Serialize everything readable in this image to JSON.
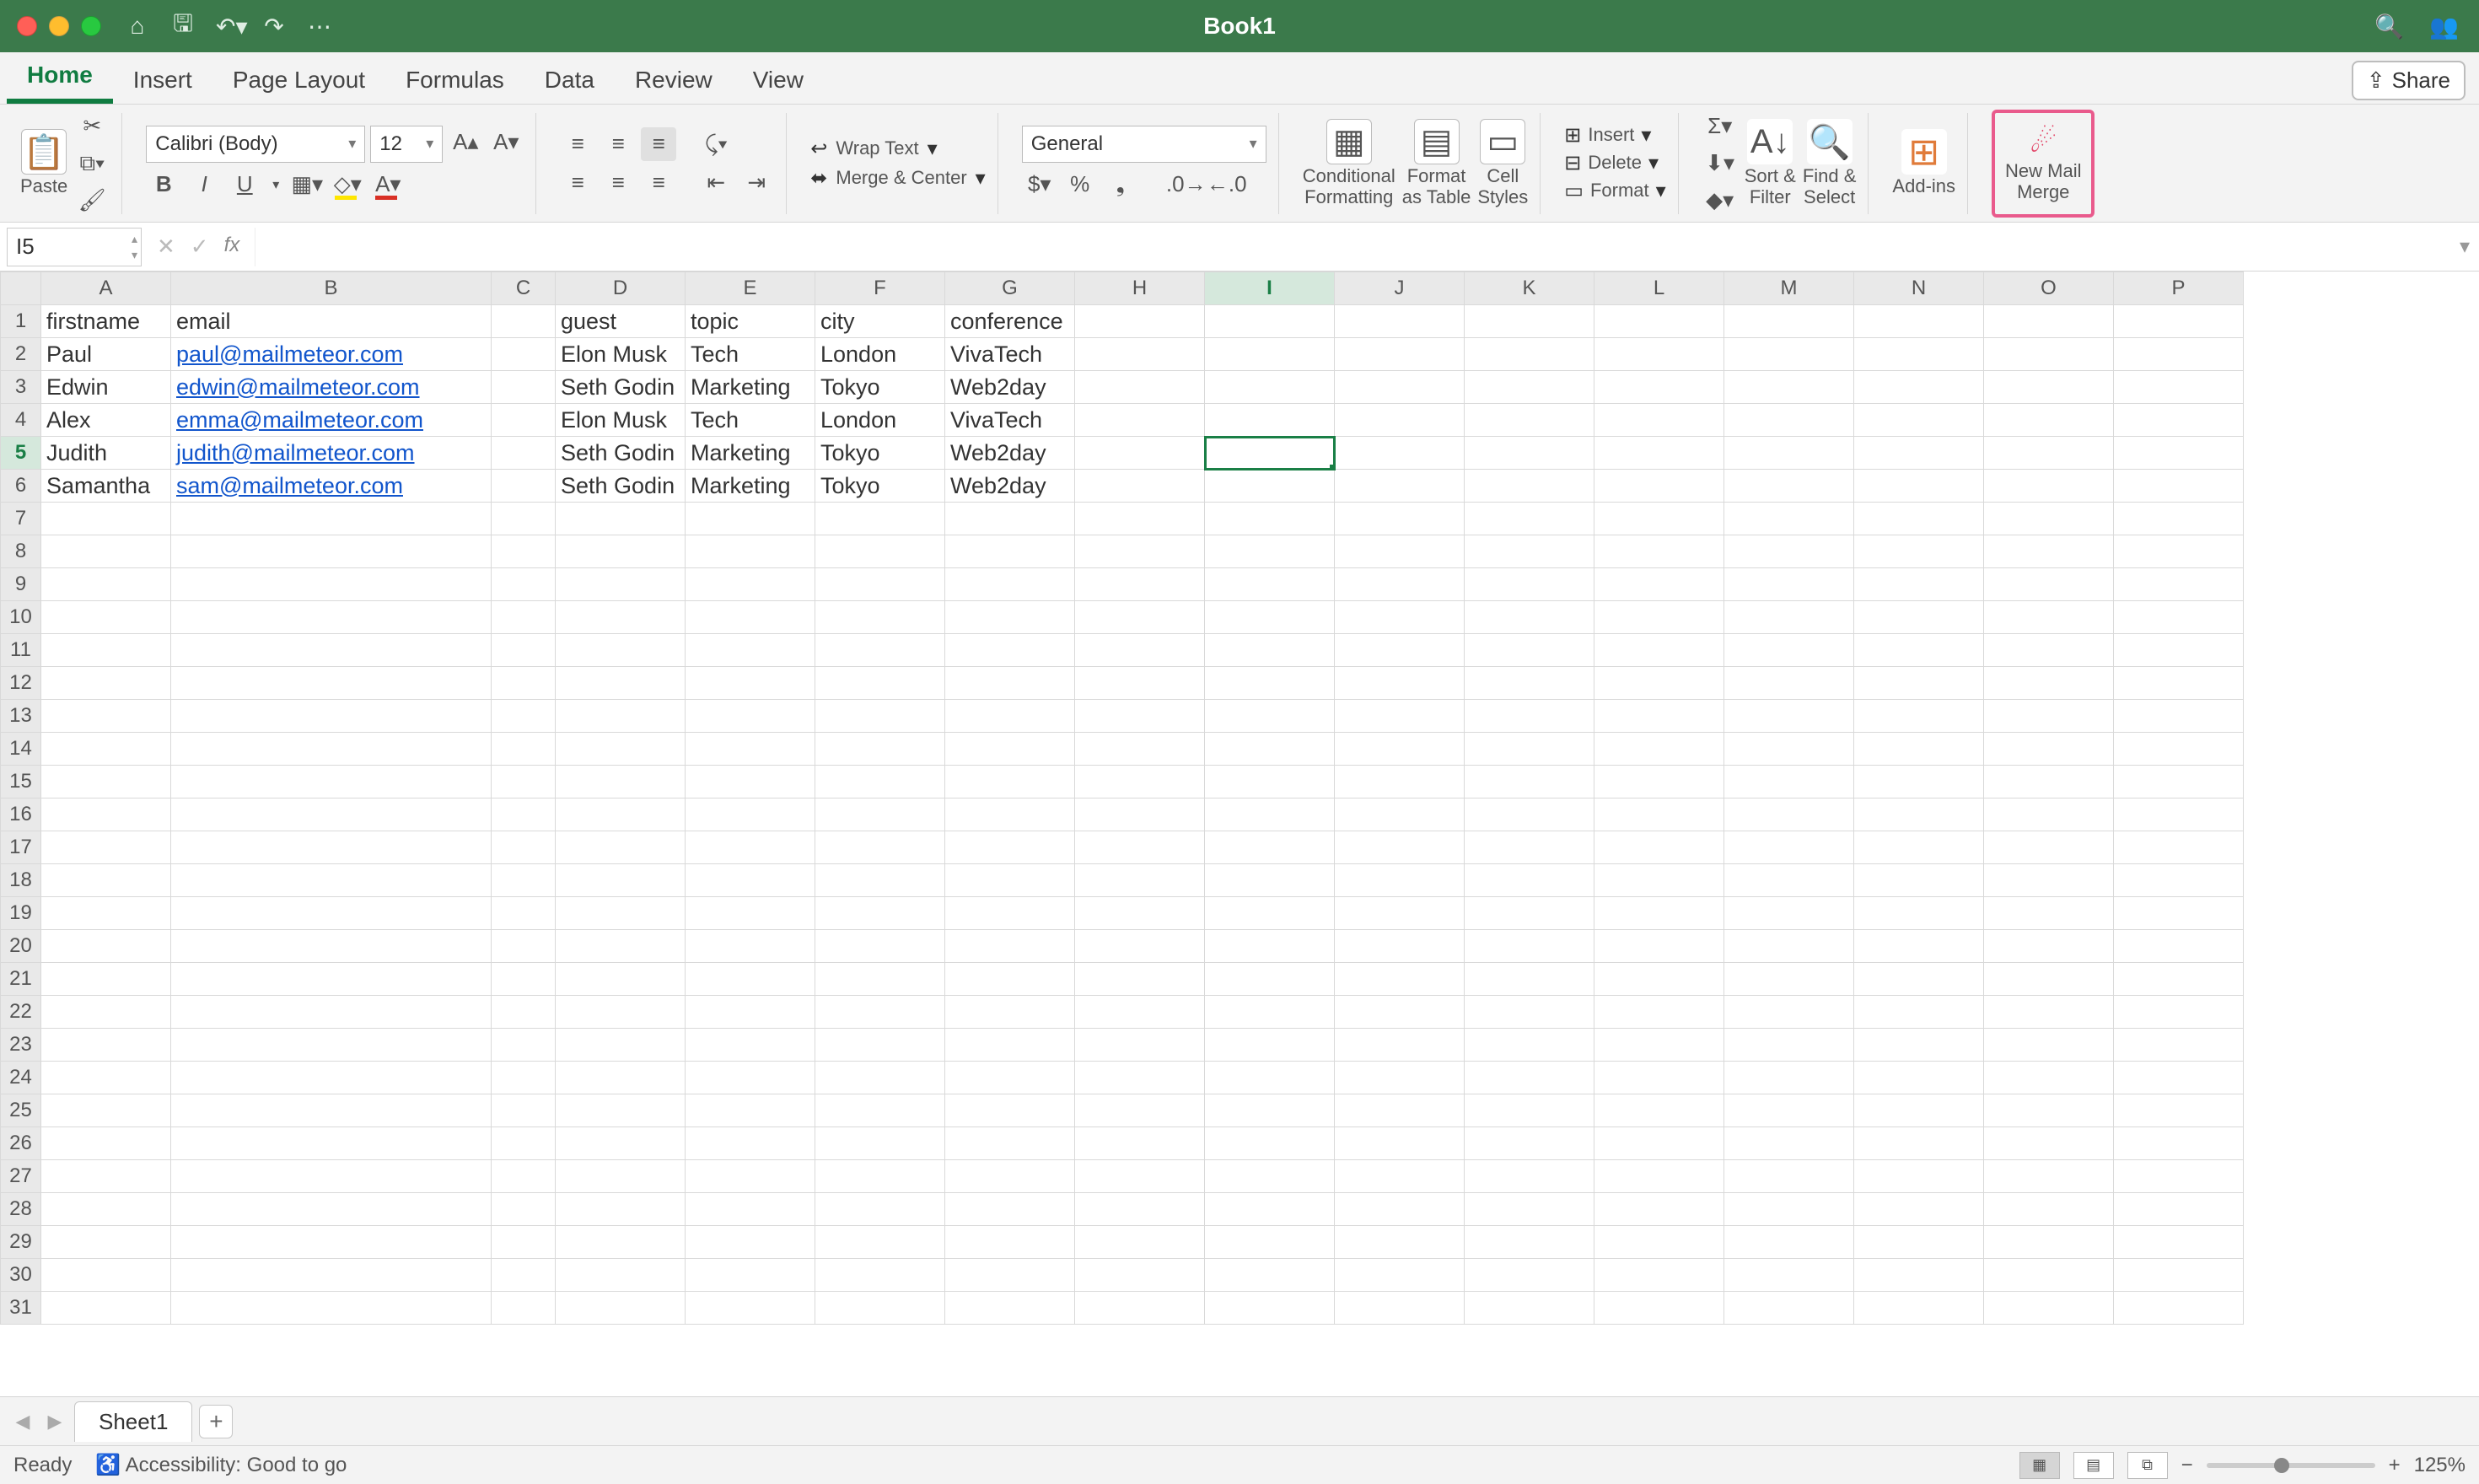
{
  "window": {
    "title": "Book1"
  },
  "qat": {
    "home": "⌂",
    "save": "💾",
    "undo": "↶",
    "redo": "↷",
    "more": "⋯"
  },
  "title_right": {
    "search": "🔍",
    "comments": "👥"
  },
  "tabs": {
    "items": [
      "Home",
      "Insert",
      "Page Layout",
      "Formulas",
      "Data",
      "Review",
      "View"
    ],
    "active": 0,
    "share": "Share"
  },
  "ribbon": {
    "clipboard": {
      "paste": "Paste"
    },
    "font": {
      "name": "Calibri (Body)",
      "size": "12",
      "bold": "B",
      "italic": "I",
      "underline": "U"
    },
    "number_format": "General",
    "wrap_text": "Wrap Text",
    "merge_center": "Merge & Center",
    "cond_format": {
      "l1": "Conditional",
      "l2": "Formatting"
    },
    "format_table": {
      "l1": "Format",
      "l2": "as Table"
    },
    "cell_styles": {
      "l1": "Cell",
      "l2": "Styles"
    },
    "cells": {
      "insert": "Insert",
      "delete": "Delete",
      "format": "Format"
    },
    "sort_filter": {
      "l1": "Sort &",
      "l2": "Filter"
    },
    "find_select": {
      "l1": "Find &",
      "l2": "Select"
    },
    "addins": "Add-ins",
    "mailmerge": {
      "l1": "New Mail",
      "l2": "Merge"
    }
  },
  "formula_bar": {
    "name_box": "I5",
    "fx": "fx",
    "value": ""
  },
  "columns": [
    "A",
    "B",
    "C",
    "D",
    "E",
    "F",
    "G",
    "H",
    "I",
    "J",
    "K",
    "L",
    "M",
    "N",
    "O",
    "P"
  ],
  "active_col": "I",
  "active_row": 5,
  "row_count": 31,
  "data": {
    "headers": [
      "firstname",
      "email",
      "",
      "guest",
      "topic",
      "city",
      "conference"
    ],
    "rows": [
      [
        "Paul",
        "paul@mailmeteor.com",
        "",
        "Elon Musk",
        "Tech",
        "London",
        "VivaTech"
      ],
      [
        "Edwin",
        "edwin@mailmeteor.com",
        "",
        "Seth Godin",
        "Marketing",
        "Tokyo",
        "Web2day"
      ],
      [
        "Alex",
        "emma@mailmeteor.com",
        "",
        "Elon Musk",
        "Tech",
        "London",
        "VivaTech"
      ],
      [
        "Judith",
        "judith@mailmeteor.com",
        "",
        "Seth Godin",
        "Marketing",
        "Tokyo",
        "Web2day"
      ],
      [
        "Samantha",
        "sam@mailmeteor.com",
        "",
        "Seth Godin",
        "Marketing",
        "Tokyo",
        "Web2day"
      ]
    ]
  },
  "sheet_tabs": {
    "active": "Sheet1"
  },
  "status": {
    "ready": "Ready",
    "accessibility": "Accessibility: Good to go",
    "zoom": "125%"
  }
}
